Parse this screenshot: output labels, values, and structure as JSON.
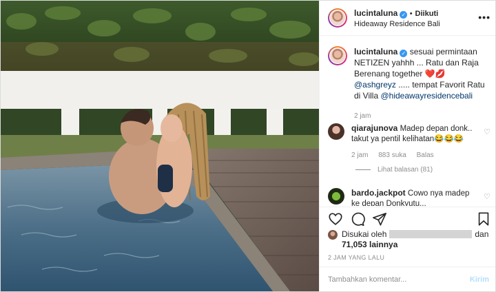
{
  "post": {
    "username": "lucintaluna",
    "follow_status": "Diikuti",
    "location": "Hideaway Residence Bali",
    "more_icon": "•••"
  },
  "caption": {
    "username": "lucintaluna",
    "text_before": "sesuai permintaan NETIZEN yahhh ... Ratu dan Raja Berenang together ",
    "emoji": "❤️💋",
    "mention1": "@ashgreyz",
    "text_middle": " ..... tempat Favorit Ratu di Villa ",
    "mention2": "@hideawayresidencebali",
    "time": "2 jam"
  },
  "comments": [
    {
      "username": "qiarajunova",
      "text": "Madep depan donk.. takut ya pentil kelihatan😂😂😂",
      "time": "2 jam",
      "likes": "883 suka",
      "reply": "Balas",
      "view_replies": "Lihat balasan (81)"
    },
    {
      "username": "bardo.jackpot",
      "text": "Cowo nya madep ke depan Donkyutu..."
    }
  ],
  "likes": {
    "prefix": "Disukai oleh",
    "connector": "dan",
    "count": "71,053 lainnya"
  },
  "date": "2 JAM YANG LALU",
  "add_comment": {
    "placeholder": "Tambahkan komentar...",
    "send": "Kirim"
  },
  "colors": {
    "link": "#003569",
    "verified": "#3897f0",
    "muted": "#8e8e8e"
  }
}
